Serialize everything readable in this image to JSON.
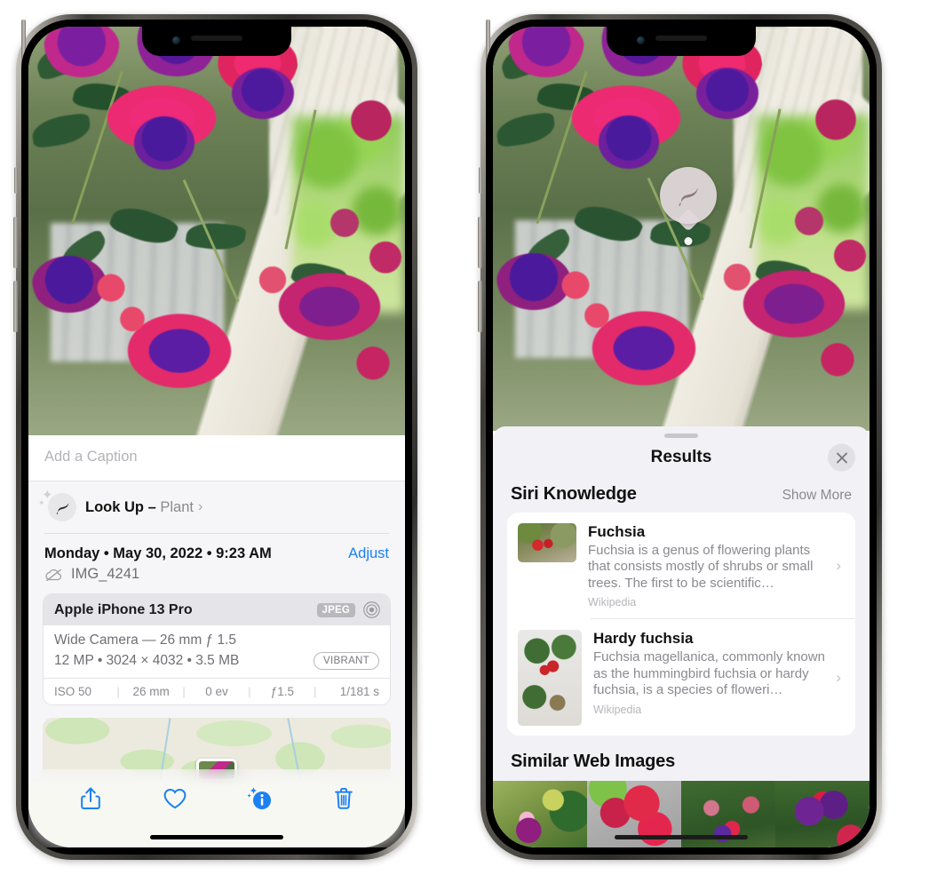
{
  "left_phone": {
    "caption_placeholder": "Add a Caption",
    "lookup": {
      "label": "Look Up – ",
      "subject": "Plant",
      "chevron": "›",
      "icon": "leaf-icon"
    },
    "date_line": "Monday • May 30, 2022 • 9:23 AM",
    "adjust_label": "Adjust",
    "file_name": "IMG_4241",
    "exif": {
      "model": "Apple iPhone 13 Pro",
      "format_badge": "JPEG",
      "lens_line": "Wide Camera — 26 mm ƒ 1.5",
      "size_line": "12 MP • 3024 × 4032 • 3.5 MB",
      "style_badge": "VIBRANT",
      "stats": [
        "ISO 50",
        "26 mm",
        "0 ev",
        "ƒ1.5",
        "1/181 s"
      ]
    },
    "toolbar": {
      "share": "share-icon",
      "favorite": "heart-icon",
      "info": "info-sparkle-icon",
      "delete": "trash-icon"
    }
  },
  "right_phone": {
    "badge_icon": "leaf-icon",
    "sheet_title": "Results",
    "close_label": "✕",
    "siri_knowledge": {
      "title": "Siri Knowledge",
      "show_more": "Show More",
      "items": [
        {
          "title": "Fuchsia",
          "desc": "Fuchsia is a genus of flowering plants that consists mostly of shrubs or small trees. The first to be scientific…",
          "source": "Wikipedia",
          "chevron": "›"
        },
        {
          "title": "Hardy fuchsia",
          "desc": "Fuchsia magellanica, commonly known as the hummingbird fuchsia or hardy fuchsia, is a species of floweri…",
          "source": "Wikipedia",
          "chevron": "›"
        }
      ]
    },
    "similar_web_images": {
      "title": "Similar Web Images",
      "thumbs": [
        "fuchsia-thumb-1",
        "fuchsia-thumb-2",
        "fuchsia-thumb-3",
        "fuchsia-thumb-4"
      ]
    }
  },
  "colors": {
    "accent_blue": "#1c80f2",
    "sheet_bg": "#f2f1f6",
    "card_bg": "#ffffff",
    "muted_text": "#8a8a90"
  }
}
